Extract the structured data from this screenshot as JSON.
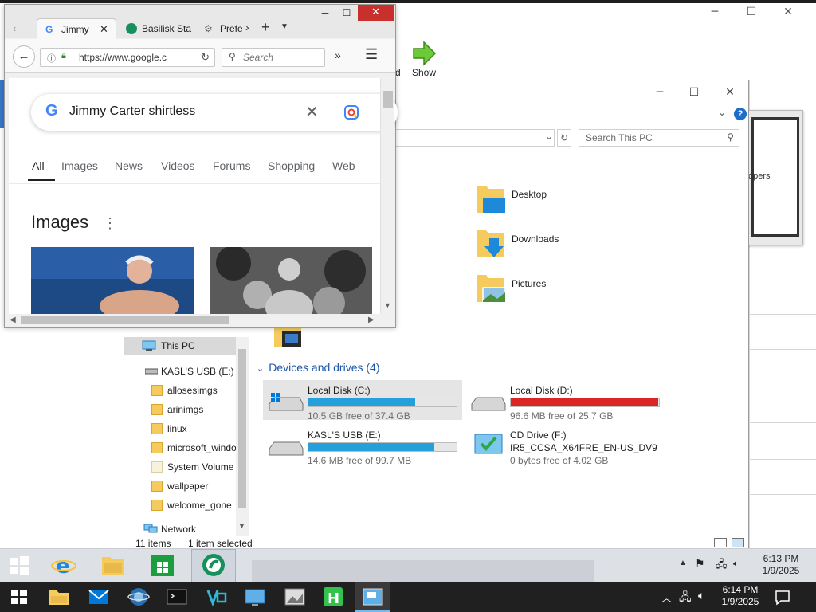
{
  "outer": {
    "window_controls": [
      "─",
      "☐",
      "✕"
    ],
    "ribbon_show_label": "Show",
    "ribbon_partial_label": "d",
    "bg_thumb_text": "opers"
  },
  "explorer": {
    "window_controls": [
      "─",
      "☐",
      "✕"
    ],
    "help": "?",
    "search_placeholder": "Search This PC",
    "folders": [
      {
        "name": "Desktop",
        "icon": "desktop-folder-icon"
      },
      {
        "name": "Downloads",
        "icon": "downloads-folder-icon"
      },
      {
        "name": "Pictures",
        "icon": "pictures-folder-icon"
      },
      {
        "name": "Videos",
        "icon": "videos-folder-icon"
      }
    ],
    "nav": [
      {
        "label": "This PC",
        "icon": "this-pc-icon"
      },
      {
        "label": "KASL'S USB (E:)",
        "icon": "usb-drive-icon"
      },
      {
        "label": "allosesimgs",
        "icon": "folder-icon"
      },
      {
        "label": "arinimgs",
        "icon": "folder-icon"
      },
      {
        "label": "linux",
        "icon": "folder-icon"
      },
      {
        "label": "microsoft_windo",
        "icon": "folder-icon"
      },
      {
        "label": "System Volume I",
        "icon": "folder-icon"
      },
      {
        "label": "wallpaper",
        "icon": "folder-icon"
      },
      {
        "label": "welcome_gone",
        "icon": "folder-icon"
      },
      {
        "label": "Network",
        "icon": "network-icon"
      }
    ],
    "devices_header": "Devices and drives (4)",
    "drives": [
      {
        "name": "Local Disk (C:)",
        "free": "10.5 GB free of 37.4 GB",
        "used_fraction": 0.72,
        "bar_color": "#26a0da"
      },
      {
        "name": "Local Disk (D:)",
        "free": "96.6 MB free of 25.7 GB",
        "used_fraction": 0.996,
        "bar_color": "#da2626"
      },
      {
        "name": "KASL'S USB (E:)",
        "free": "14.6 MB free of 99.7 MB",
        "used_fraction": 0.85,
        "bar_color": "#26a0da"
      },
      {
        "name": "CD Drive (F:)",
        "subtitle": "IR5_CCSA_X64FRE_EN-US_DV9",
        "free": "0 bytes free of 4.02 GB"
      }
    ],
    "status_items": "11 items",
    "status_selected": "1 item selected"
  },
  "browser": {
    "tabs": [
      {
        "label": "Jimmy",
        "icon": "google-icon"
      },
      {
        "label": "Basilisk Sta",
        "icon": "basilisk-icon"
      },
      {
        "label": "Prefe",
        "icon": "gear-icon"
      }
    ],
    "window_controls": [
      "─",
      "☐",
      "✕"
    ],
    "url": "https://www.google.c",
    "search_placeholder": "Search",
    "query": "Jimmy Carter shirtless",
    "result_tabs": [
      "All",
      "Images",
      "News",
      "Videos",
      "Forums",
      "Shopping",
      "Web"
    ],
    "active_tab": "All",
    "images_header": "Images"
  },
  "inner_clock": {
    "time": "6:13 PM",
    "date": "1/9/2025"
  },
  "outer_clock": {
    "time": "6:14 PM",
    "date": "1/9/2025"
  }
}
